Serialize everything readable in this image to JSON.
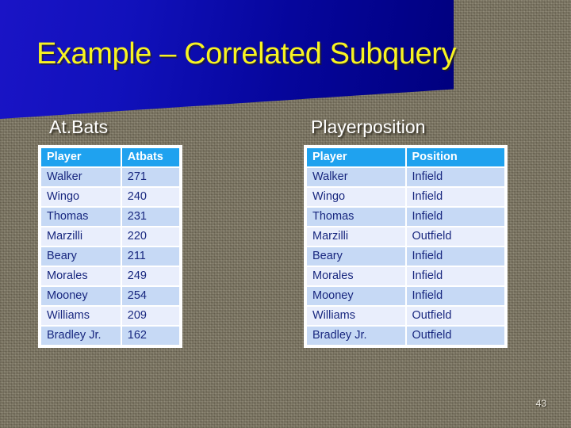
{
  "slide": {
    "title": "Example – Correlated Subquery",
    "page_number": "43",
    "colors": {
      "banner_blue_light": "#1a14c6",
      "banner_blue_dark": "#00007e",
      "title_yellow": "#f8f422",
      "background_khaki": "#7e7761",
      "table_header_blue": "#1fa2ef",
      "table_row_odd": "#c6d9f5",
      "table_row_even": "#e9eefc",
      "table_text_navy": "#17267e",
      "caption_white": "#ffffff"
    }
  },
  "tables": {
    "atbats": {
      "caption": "At.Bats",
      "columns": [
        "Player",
        "Atbats"
      ],
      "rows": [
        [
          "Walker",
          "271"
        ],
        [
          "Wingo",
          "240"
        ],
        [
          "Thomas",
          "231"
        ],
        [
          "Marzilli",
          "220"
        ],
        [
          "Beary",
          "211"
        ],
        [
          "Morales",
          "249"
        ],
        [
          "Mooney",
          "254"
        ],
        [
          "Williams",
          "209"
        ],
        [
          "Bradley Jr.",
          "162"
        ]
      ]
    },
    "playerposition": {
      "caption": "Playerposition",
      "columns": [
        "Player",
        "Position"
      ],
      "rows": [
        [
          "Walker",
          "Infield"
        ],
        [
          "Wingo",
          "Infield"
        ],
        [
          "Thomas",
          "Infield"
        ],
        [
          "Marzilli",
          "Outfield"
        ],
        [
          "Beary",
          "Infield"
        ],
        [
          "Morales",
          "Infield"
        ],
        [
          "Mooney",
          "Infield"
        ],
        [
          "Williams",
          "Outfield"
        ],
        [
          "Bradley Jr.",
          "Outfield"
        ]
      ]
    }
  }
}
